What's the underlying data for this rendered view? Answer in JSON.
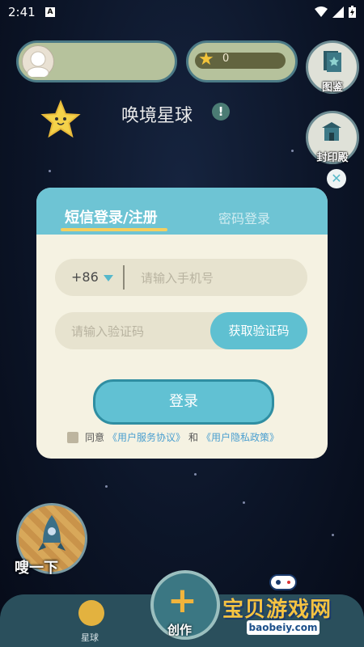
{
  "status_bar": {
    "time": "2:41"
  },
  "header": {
    "coin_value": "0",
    "planet_title": "唤境星球",
    "atlas_label": "图鉴",
    "seal_hall_label": "封印殿"
  },
  "login_modal": {
    "tab_sms": "短信登录/注册",
    "tab_password": "密码登录",
    "country_code": "+86",
    "phone_placeholder": "请输入手机号",
    "code_placeholder": "请输入验证码",
    "get_code_label": "获取验证码",
    "login_label": "登录",
    "agree_prefix": "同意",
    "user_agreement": "《用户服务协议》",
    "and": "和",
    "privacy_policy": "《用户隐私政策》"
  },
  "bottom": {
    "rocket_label": "嗖一下",
    "planet_tab_label": "星球",
    "create_label": "创作"
  },
  "watermark": {
    "title": "宝贝游戏网",
    "url": "baobeiy.com"
  },
  "colors": {
    "accent": "#6ec4d4",
    "modal_bg": "#f5f2e2",
    "tab_underline": "#f4cf60",
    "link": "#4a9fd0"
  }
}
